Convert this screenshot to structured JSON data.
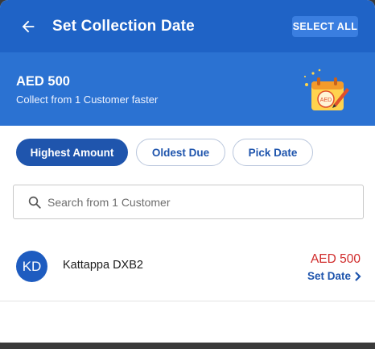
{
  "appbar": {
    "title": "Set Collection Date",
    "select_all_label": "SELECT ALL",
    "back_icon": "arrow-left-icon"
  },
  "summary": {
    "amount": "AED 500",
    "subtitle": "Collect from 1 Customer faster",
    "illustration_badge": "AED"
  },
  "filters": {
    "chips": [
      {
        "label": "Highest Amount",
        "active": true
      },
      {
        "label": "Oldest Due",
        "active": false
      },
      {
        "label": "Pick Date",
        "active": false
      }
    ]
  },
  "search": {
    "placeholder": "Search from 1 Customer",
    "value": ""
  },
  "customers": [
    {
      "initials": "KD",
      "name": "Kattappa DXB2",
      "amount": "AED 500",
      "action_label": "Set Date"
    }
  ],
  "colors": {
    "appbar": "#1f63c6",
    "summary": "#2b72d2",
    "primary": "#1f55ad",
    "amount_due": "#d02b2b"
  }
}
